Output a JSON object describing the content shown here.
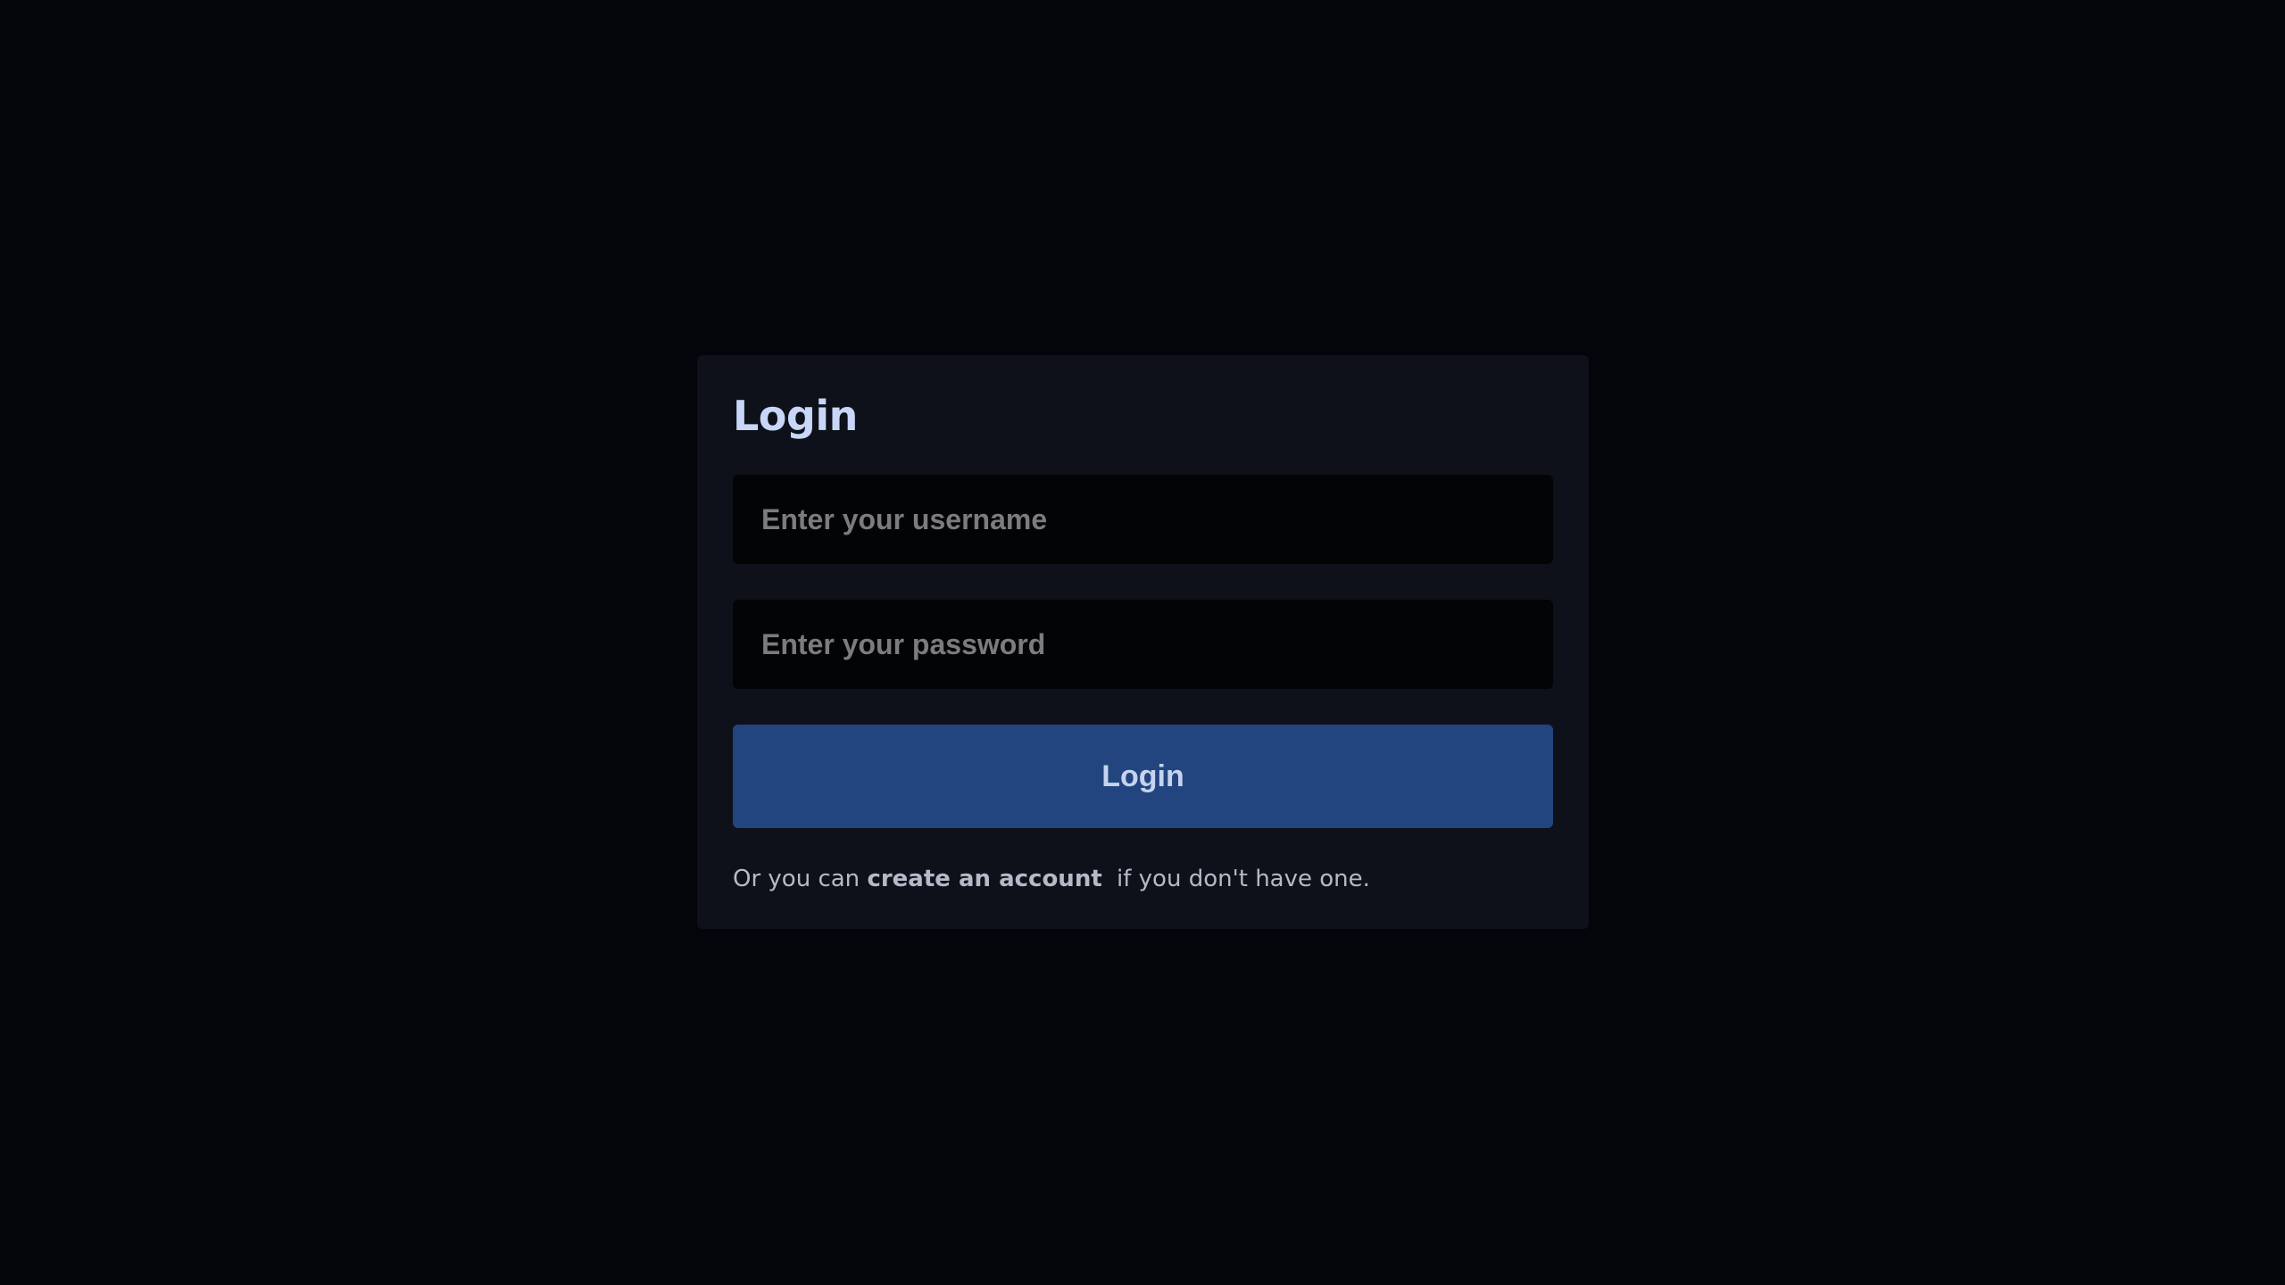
{
  "login_card": {
    "title": "Login",
    "username": {
      "value": "",
      "placeholder": "Enter your username"
    },
    "password": {
      "value": "",
      "placeholder": "Enter your password"
    },
    "submit_label": "Login",
    "footer": {
      "prefix": "Or you can ",
      "link_label": "create an account",
      "suffix": " if you don't have one."
    }
  },
  "colors": {
    "background": "#03050a",
    "card": "#0e1119",
    "input": "#030406",
    "button": "#224580",
    "title_text": "#c8d6f8"
  }
}
